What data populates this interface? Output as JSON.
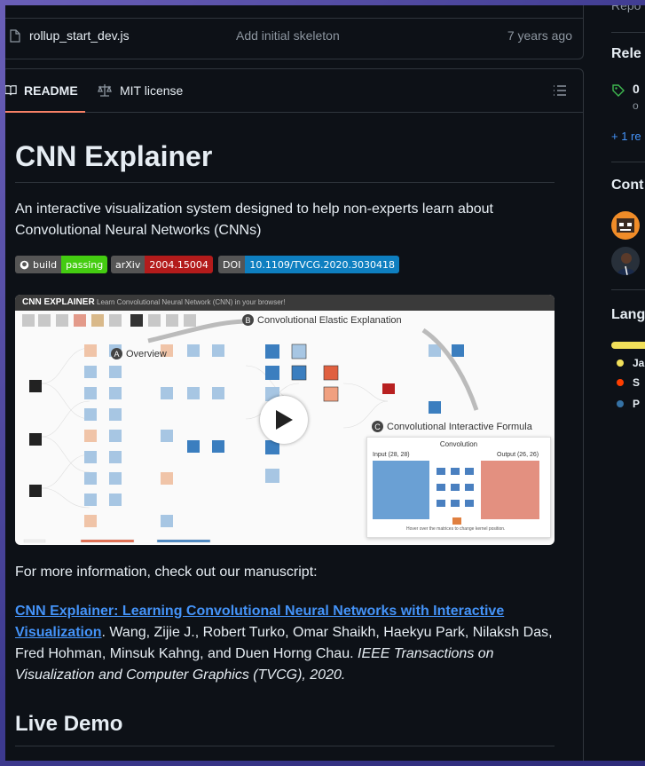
{
  "files": {
    "row": {
      "name": "rollup_start_dev.js",
      "message": "Add initial skeleton",
      "time": "7 years ago"
    }
  },
  "readme": {
    "tabs": {
      "readme": "README",
      "license": "MIT license"
    },
    "title": "CNN Explainer",
    "description": "An interactive visualization system designed to help non-experts learn about Convolutional Neural Networks (CNNs)",
    "badges": [
      {
        "label": "build",
        "value": "passing",
        "color": "#44cc11"
      },
      {
        "label": "arXiv",
        "value": "2004.15004",
        "color": "#b31b1b"
      },
      {
        "label": "DOI",
        "value": "10.1109/TVCG.2020.3030418",
        "color": "#0e7fc0"
      }
    ],
    "video": {
      "header_title": "CNN EXPLAINER",
      "header_sub": "Learn Convolutional Neural Network (CNN) in your browser!",
      "anno_a": "Overview",
      "anno_b": "Convolutional Elastic Explanation",
      "anno_c": "Convolutional Interactive Formula",
      "panel_title": "Convolution",
      "panel_input": "Input (28, 28)",
      "panel_output": "Output (26, 26)",
      "panel_foot": "Hover over the matrices to change kernel position."
    },
    "more_info": "For more information, check out our manuscript:",
    "citation": {
      "link": "CNN Explainer: Learning Convolutional Neural Networks with Interactive Visualization",
      "authors": ". Wang, Zijie J., Robert Turko, Omar Shaikh, Haekyu Park, Nilaksh Das, Fred Hohman, Minsuk Kahng, and Duen Horng Chau. ",
      "journal": "IEEE Transactions on Visualization and Computer Graphics (TVCG), 2020."
    },
    "live_demo": "Live Demo"
  },
  "sidebar": {
    "top_muted": "Repo",
    "releases_heading": "Rele",
    "release_tag": "0",
    "release_sub": "o",
    "more_releases": "+ 1 re",
    "contributors_heading": "Cont",
    "languages_heading": "Lang",
    "languages": [
      {
        "label": "Ja",
        "color": "#f1e05a"
      },
      {
        "label": "S",
        "color": "#ff3e00"
      },
      {
        "label": "P",
        "color": "#3572A5"
      }
    ]
  }
}
